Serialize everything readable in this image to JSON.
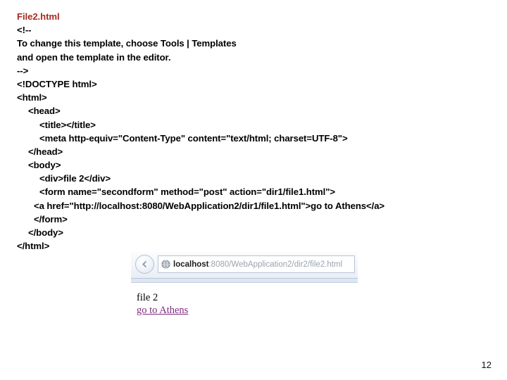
{
  "slide": {
    "title": "File2.html",
    "page_number": "12",
    "title_color": "#a82a20"
  },
  "code_listing": {
    "lines": [
      {
        "text": "<!--",
        "indent": 0
      },
      {
        "text": "To change this template, choose Tools | Templates",
        "indent": 0
      },
      {
        "text": "and open the template in the editor.",
        "indent": 0
      },
      {
        "text": "-->",
        "indent": 0
      },
      {
        "text": "<!DOCTYPE html>",
        "indent": 0
      },
      {
        "text": "<html>",
        "indent": 0
      },
      {
        "text": "<head>",
        "indent": 1
      },
      {
        "text": "<title></title>",
        "indent": 2
      },
      {
        "text": "<meta http-equiv=\"Content-Type\" content=\"text/html; charset=UTF-8\">",
        "indent": 2
      },
      {
        "text": "</head>",
        "indent": 1
      },
      {
        "text": "<body>",
        "indent": 1
      },
      {
        "text": "<div>file 2</div>",
        "indent": 2
      },
      {
        "text": "<form name=\"secondform\" method=\"post\" action=\"dir1/file1.html\">",
        "indent": 2
      },
      {
        "text": "<a href=\"http://localhost:8080/WebApplication2/dir1/file1.html\">go to Athens</a>",
        "indent": 3
      },
      {
        "text": "</form>",
        "indent": 3
      },
      {
        "text": "</body>",
        "indent": 1
      },
      {
        "text": "</html>",
        "indent": 0
      }
    ]
  },
  "browser_screenshot": {
    "back_button_label": "Back",
    "back_icon": "arrow-left-icon",
    "favicon": "globe-icon",
    "url_host": "localhost",
    "url_path": ":8080/WebApplication2/dir2/file2.html",
    "page_content": {
      "heading_text": "file 2",
      "link_text": "go to Athens",
      "link_color": "#7d2a7d"
    }
  }
}
